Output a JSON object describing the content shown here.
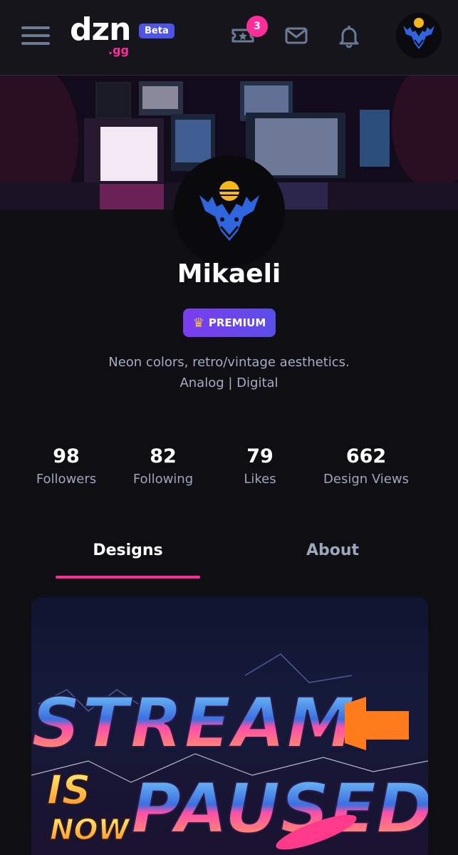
{
  "header": {
    "logo_text": "dzn",
    "logo_sub": ".gg",
    "beta_label": "Beta",
    "notification_count": "3",
    "icons": [
      "menu-icon",
      "ticket-star-icon",
      "mail-icon",
      "bell-icon"
    ]
  },
  "profile": {
    "username": "Mikaeli",
    "badge_label": "PREMIUM",
    "bio_line1": "Neon colors, retro/vintage aesthetics.",
    "bio_line2": "Analog | Digital"
  },
  "stats": [
    {
      "value": "98",
      "label": "Followers"
    },
    {
      "value": "82",
      "label": "Following"
    },
    {
      "value": "79",
      "label": "Likes"
    },
    {
      "value": "662",
      "label": "Design Views"
    }
  ],
  "tabs": [
    {
      "label": "Designs",
      "active": true
    },
    {
      "label": "About",
      "active": false
    }
  ],
  "design_card": {
    "line1": "STREAM",
    "line2a": "IS",
    "line2b": "NOW",
    "line3": "PAUSED"
  },
  "colors": {
    "accent_pink": "#ff2d9a",
    "beta_blue": "#4f53e6",
    "premium_purple": "#7b3df0"
  }
}
